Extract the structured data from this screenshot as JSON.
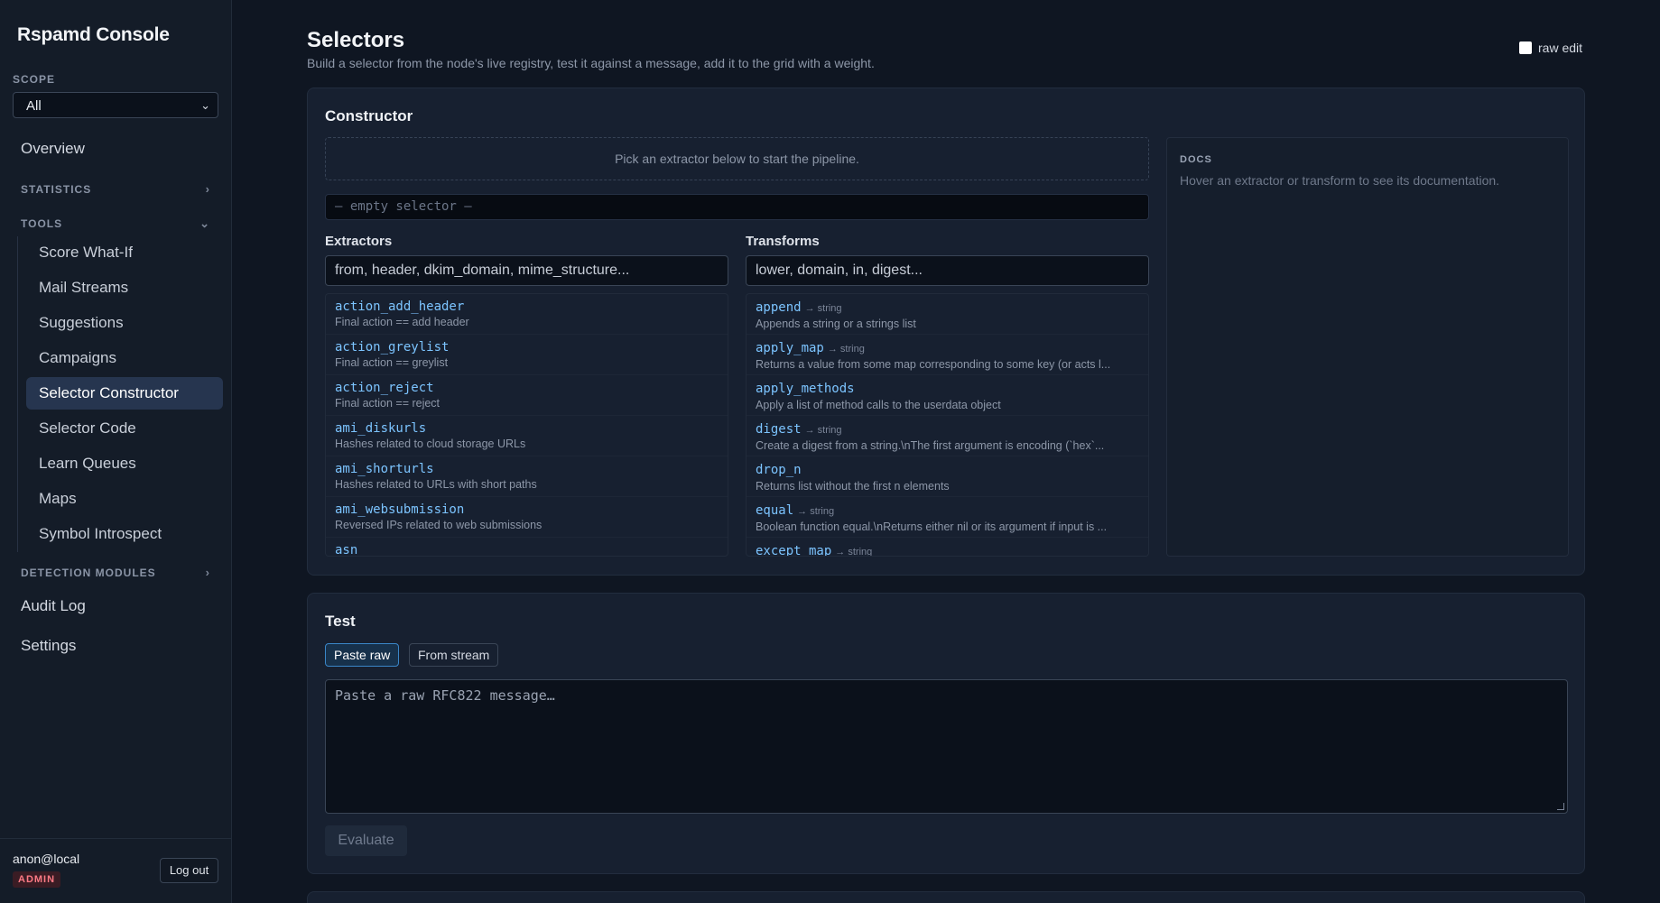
{
  "sidebar": {
    "brand": "Rspamd Console",
    "scope_label": "SCOPE",
    "scope_value": "All",
    "overview": "Overview",
    "statistics": "STATISTICS",
    "tools": "TOOLS",
    "tool_items": [
      "Score What-If",
      "Mail Streams",
      "Suggestions",
      "Campaigns",
      "Selector Constructor",
      "Selector Code",
      "Learn Queues",
      "Maps",
      "Symbol Introspect"
    ],
    "active_tool": "Selector Constructor",
    "detection_modules": "DETECTION MODULES",
    "audit_log": "Audit Log",
    "settings": "Settings",
    "user": "anon@local",
    "role": "ADMIN",
    "logout": "Log out"
  },
  "header": {
    "title": "Selectors",
    "subtitle": "Build a selector from the node's live registry, test it against a message, add it to the grid with a weight.",
    "raw_edit": "raw edit"
  },
  "constructor": {
    "title": "Constructor",
    "pipeline_hint": "Pick an extractor below to start the pipeline.",
    "selector_output": "— empty selector —",
    "extractors_label": "Extractors",
    "extractors_placeholder": "from, header, dkim_domain, mime_structure...",
    "extractors": [
      {
        "name": "action_add_header",
        "desc": "Final action == add header"
      },
      {
        "name": "action_greylist",
        "desc": "Final action == greylist"
      },
      {
        "name": "action_reject",
        "desc": "Final action == reject"
      },
      {
        "name": "ami_diskurls",
        "desc": "Hashes related to cloud storage URLs"
      },
      {
        "name": "ami_shorturls",
        "desc": "Hashes related to URLs with short paths"
      },
      {
        "name": "ami_websubmission",
        "desc": "Reversed IPs related to web submissions"
      },
      {
        "name": "asn",
        "desc": ""
      }
    ],
    "transforms_label": "Transforms",
    "transforms_placeholder": "lower, domain, in, digest...",
    "transforms": [
      {
        "name": "append",
        "ret": "→ string",
        "desc": "Appends a string or a strings list"
      },
      {
        "name": "apply_map",
        "ret": "→ string",
        "desc": "Returns a value from some map corresponding to some key (or acts l..."
      },
      {
        "name": "apply_methods",
        "ret": "",
        "desc": "Apply a list of method calls to the userdata object"
      },
      {
        "name": "digest",
        "ret": "→ string",
        "desc": "Create a digest from a string.\\nThe first argument is encoding (`hex`..."
      },
      {
        "name": "drop_n",
        "ret": "",
        "desc": "Returns list without the first n elements"
      },
      {
        "name": "equal",
        "ret": "→ string",
        "desc": "Boolean function equal.\\nReturns either nil or its argument if input is ..."
      },
      {
        "name": "except_map",
        "ret": "→ string",
        "desc": ""
      }
    ],
    "docs_label": "DOCS",
    "docs_text": "Hover an extractor or transform to see its documentation."
  },
  "test": {
    "title": "Test",
    "tab_paste": "Paste raw",
    "tab_stream": "From stream",
    "message_placeholder": "Paste a raw RFC822 message…",
    "evaluate": "Evaluate"
  }
}
